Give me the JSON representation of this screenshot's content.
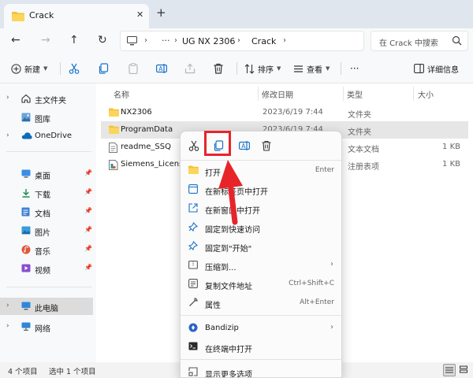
{
  "tab": {
    "title": "Crack",
    "close": "✕",
    "new": "+"
  },
  "nav": {
    "back": "←",
    "forward": "→",
    "up": "↑",
    "refresh": "↻"
  },
  "address": {
    "ellipsis": "···",
    "crumbs": [
      "UG NX 2306",
      "Crack"
    ],
    "search_placeholder": "在 Crack 中搜索"
  },
  "toolbar": {
    "new_label": "新建",
    "sort_label": "排序",
    "view_label": "查看",
    "more_label": "···",
    "details_label": "详细信息"
  },
  "sidebar": {
    "items": [
      {
        "label": "主文件夹",
        "icon": "home-icon"
      },
      {
        "label": "图库",
        "icon": "gallery-icon"
      },
      {
        "label": "OneDrive",
        "icon": "cloud-icon"
      },
      {
        "label": "桌面",
        "icon": "desktop-icon"
      },
      {
        "label": "下载",
        "icon": "download-icon"
      },
      {
        "label": "文档",
        "icon": "document-icon"
      },
      {
        "label": "图片",
        "icon": "picture-icon"
      },
      {
        "label": "音乐",
        "icon": "music-icon"
      },
      {
        "label": "视频",
        "icon": "video-icon"
      },
      {
        "label": "此电脑",
        "icon": "pc-icon"
      },
      {
        "label": "网络",
        "icon": "network-icon"
      }
    ]
  },
  "columns": {
    "name": "名称",
    "date": "修改日期",
    "type": "类型",
    "size": "大小"
  },
  "files": [
    {
      "name": "NX2306",
      "date": "2023/6/19 7:44",
      "type": "文件夹",
      "size": ""
    },
    {
      "name": "ProgramData",
      "date": "2023/6/19 7:44",
      "type": "文件夹",
      "size": ""
    },
    {
      "name": "readme_SSQ",
      "date": "",
      "type": "文本文档",
      "size": "1 KB"
    },
    {
      "name": "Siemens_Licensing",
      "date": "",
      "type": "注册表项",
      "size": "1 KB"
    }
  ],
  "status": {
    "count": "4 个项目",
    "selected": "选中 1 个项目"
  },
  "context_menu": {
    "items": [
      {
        "label": "打开",
        "shortcut": "Enter"
      },
      {
        "label": "在新标签页中打开",
        "shortcut": ""
      },
      {
        "label": "在新窗口中打开",
        "shortcut": ""
      },
      {
        "label": "固定到快速访问",
        "shortcut": ""
      },
      {
        "label": "固定到\"开始\"",
        "shortcut": ""
      },
      {
        "label": "压缩到...",
        "shortcut": ""
      },
      {
        "label": "复制文件地址",
        "shortcut": "Ctrl+Shift+C"
      },
      {
        "label": "属性",
        "shortcut": "Alt+Enter"
      },
      {
        "label": "Bandizip",
        "shortcut": ""
      },
      {
        "label": "在终端中打开",
        "shortcut": ""
      },
      {
        "label": "显示更多选项",
        "shortcut": ""
      }
    ]
  },
  "colors": {
    "accent": "#0067c0",
    "folder": "#f3c23c",
    "highlight": "#e8242b",
    "selection": "#e6e6e6"
  }
}
